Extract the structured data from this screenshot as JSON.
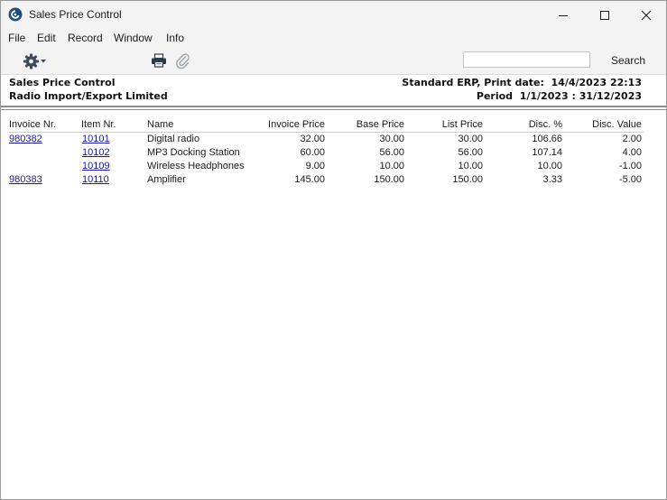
{
  "window": {
    "title": "Sales Price Control",
    "controls": [
      "minimize-icon",
      "maximize-icon",
      "close-icon"
    ]
  },
  "menu": [
    "File",
    "Edit",
    "Record",
    "Window",
    "Info"
  ],
  "toolbar": {
    "icons": [
      "gear-icon",
      "printer-icon",
      "paperclip-icon"
    ],
    "search_value": "",
    "search_label": "Search"
  },
  "report": {
    "title": "Sales Price Control",
    "company": "Radio Import/Export Limited",
    "system_line": "Standard ERP, Print date:  14/4/2023 22:13",
    "period_line": "Period  1/1/2023 : 31/12/2023"
  },
  "table": {
    "columns": [
      "Invoice Nr.",
      "Item Nr.",
      "Name",
      "Invoice Price",
      "Base Price",
      "List Price",
      "Disc. %",
      "Disc. Value"
    ],
    "rows": [
      {
        "invoice": "980382",
        "item": "10101",
        "name": "Digital radio",
        "invoice_price": "32.00",
        "base_price": "30.00",
        "list_price": "30.00",
        "disc_pct": "106.66",
        "disc_value": "2.00"
      },
      {
        "invoice": "",
        "item": "10102",
        "name": "MP3 Docking Station",
        "invoice_price": "60.00",
        "base_price": "56.00",
        "list_price": "56.00",
        "disc_pct": "107.14",
        "disc_value": "4.00"
      },
      {
        "invoice": "",
        "item": "10109",
        "name": "Wireless Headphones",
        "invoice_price": "9.00",
        "base_price": "10.00",
        "list_price": "10.00",
        "disc_pct": "10.00",
        "disc_value": "-1.00"
      },
      {
        "invoice": "980383",
        "item": "10110",
        "name": "Amplifier",
        "invoice_price": "145.00",
        "base_price": "150.00",
        "list_price": "150.00",
        "disc_pct": "3.33",
        "disc_value": "-5.00"
      }
    ]
  },
  "colors": {
    "chrome": "#f3f3f3",
    "link": "#1a1a9a",
    "app_icon": "#1f4e79"
  }
}
